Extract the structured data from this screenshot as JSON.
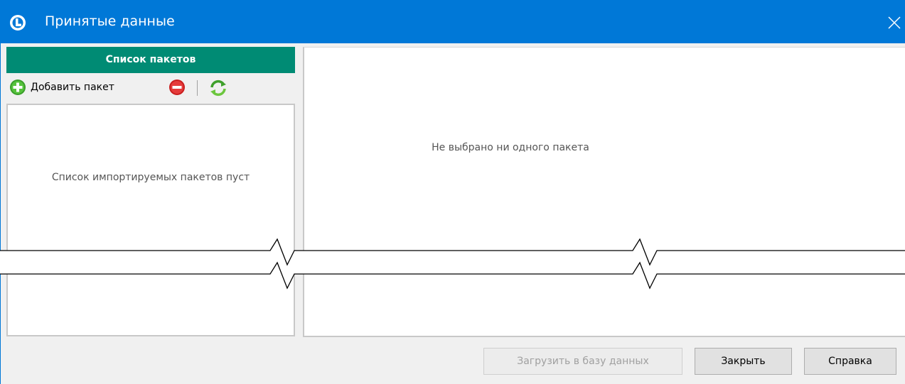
{
  "window": {
    "title": "Принятые данные",
    "accent_color": "#0078d7",
    "close_icon": "close-icon"
  },
  "packages_panel": {
    "header": "Список пакетов",
    "header_color": "#008b74",
    "toolbar": {
      "add_label": "Добавить пакет",
      "add_icon": "plus-circle-icon",
      "remove_icon": "minus-circle-icon",
      "refresh_icon": "refresh-icon"
    },
    "empty_text": "Список импортируемых пакетов пуст"
  },
  "details_panel": {
    "empty_text": "Не выбрано ни одного пакета"
  },
  "buttons": {
    "load": "Загрузить в базу данных",
    "close": "Закрыть",
    "help": "Справка"
  }
}
